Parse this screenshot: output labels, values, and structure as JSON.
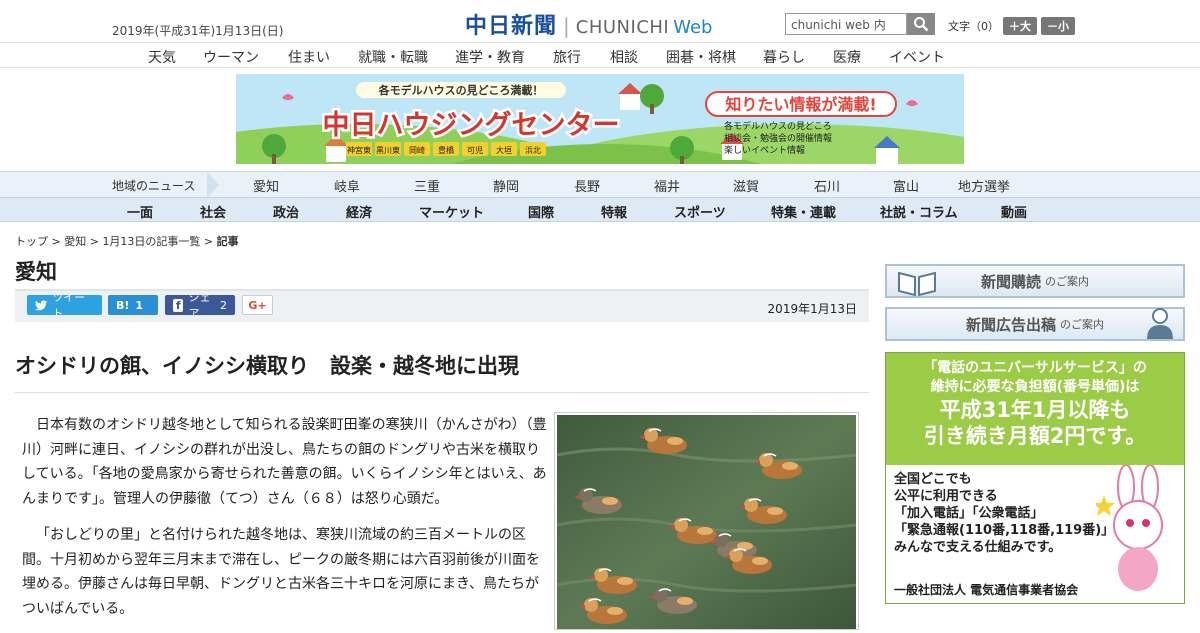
{
  "header": {
    "date": "2019年(平成31年)1月13日(日)",
    "logo_jp": "中日新聞",
    "logo_en": "CHUNICHI",
    "logo_web": "Web",
    "search_value": "chunichi web 内",
    "fontsize_label": "文字（0）",
    "fontsize_up": "＋大",
    "fontsize_down": "－小"
  },
  "topnav": [
    "天気",
    "ウーマン",
    "住まい",
    "就職・転職",
    "進学・教育",
    "旅行",
    "相談",
    "囲碁・将棋",
    "暮らし",
    "医療",
    "イベント"
  ],
  "banner": {
    "tagline": "各モデルハウスの見どころ満載！",
    "title": "中日ハウジングセンター",
    "badge": "知りたい情報が満載!",
    "bullets": [
      "各モデルハウスの見どころ",
      "相談会・勉強会の開催情報",
      "楽しいイベント情報"
    ],
    "locations": [
      "神宮東",
      "黒川東",
      "岡崎",
      "豊橋",
      "可児",
      "大垣",
      "浜北"
    ]
  },
  "region": {
    "label": "地域のニュース",
    "items": [
      "愛知",
      "岐阜",
      "三重",
      "静岡",
      "長野",
      "福井",
      "滋賀",
      "石川",
      "富山",
      "地方選挙"
    ]
  },
  "genre": [
    "一面",
    "社会",
    "政治",
    "経済",
    "マーケット",
    "国際",
    "特報",
    "スポーツ",
    "特集・連載",
    "社説・コラム",
    "動画"
  ],
  "breadcrumb": {
    "top": "トップ",
    "sep": " > ",
    "aichi": "愛知",
    "list": "1月13日の記事一覧",
    "current": "記事"
  },
  "section_title": "愛知",
  "share": {
    "tweet": "ツイート",
    "hatena_count": "1",
    "fb_label": "シェア",
    "fb_count": "2",
    "gplus": "G+",
    "date": "2019年1月13日"
  },
  "article": {
    "headline": "オシドリの餌、イノシシ横取り　設楽・越冬地に出現",
    "paragraphs": [
      "日本有数のオシドリ越冬地として知られる設楽町田峯の寒狭川（かんさがわ）（豊川）河畔に連日、イノシシの群れが出没し、鳥たちの餌のドングリや古米を横取りしている。「各地の愛鳥家から寄せられた善意の餌。いくらイノシシ年とはいえ、あんまりです」。管理人の伊藤徹（てつ）さん（６８）は怒り心頭だ。",
      "「おしどりの里」と名付けられた越冬地は、寒狭川流域の約三百メートルの区間。十月初めから翌年三月末まで滞在し、ピークの厳冬期には六百羽前後が川面を埋める。伊藤さんは毎日早朝、ドングリと古米各三十キロを河原にまき、鳥たちがついばんでいる。"
    ]
  },
  "sidebar": {
    "subscribe": "新聞購読",
    "subscribe_small": "のご案内",
    "advertise": "新聞広告出稿",
    "advertise_small": "のご案内"
  },
  "ad": {
    "line1": "「電話のユニバーサルサービス」の",
    "line2": "維持に必要な負担額(番号単価)は",
    "line3": "平成31年1月以降も",
    "line4": "引き続き月額2円です。",
    "b1": "全国どこでも",
    "b2": "公平に利用できる",
    "b3": "「加入電話」「公衆電話」",
    "b4": "「緊急通報(110番,118番,119番)」を",
    "b5": "みんなで支える仕組みです。",
    "org": "一般社団法人 電気通信事業者協会"
  }
}
